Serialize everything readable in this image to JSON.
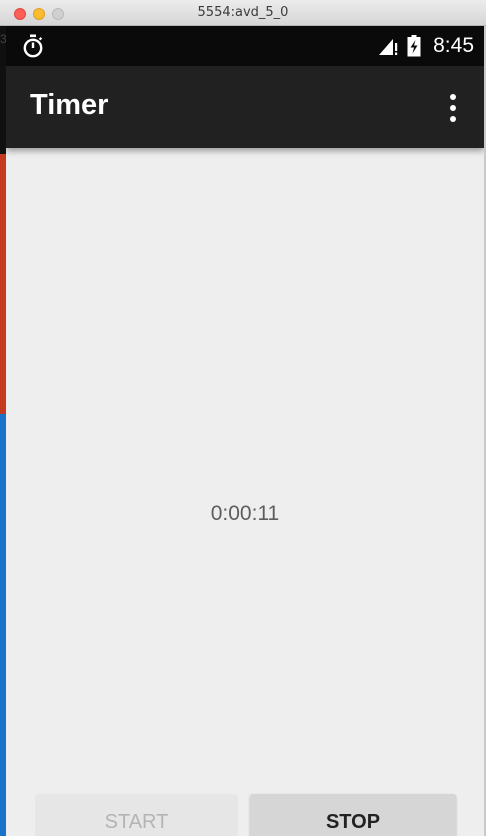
{
  "window": {
    "title": "5554:avd_5_0"
  },
  "background": {
    "left_glyph": "3"
  },
  "status_bar": {
    "time": "8:45",
    "icons": [
      "stopwatch-icon",
      "signal-icon",
      "battery-charging-icon"
    ]
  },
  "app_bar": {
    "title": "Timer",
    "overflow_icon": "more-vert-icon"
  },
  "timer": {
    "display": "0:00:11"
  },
  "buttons": {
    "start_label": "START",
    "start_enabled": false,
    "stop_label": "STOP",
    "stop_enabled": true
  },
  "colors": {
    "status_bar": "#0a0a0a",
    "app_bar": "#212121",
    "screen_background": "#eeeeee"
  }
}
